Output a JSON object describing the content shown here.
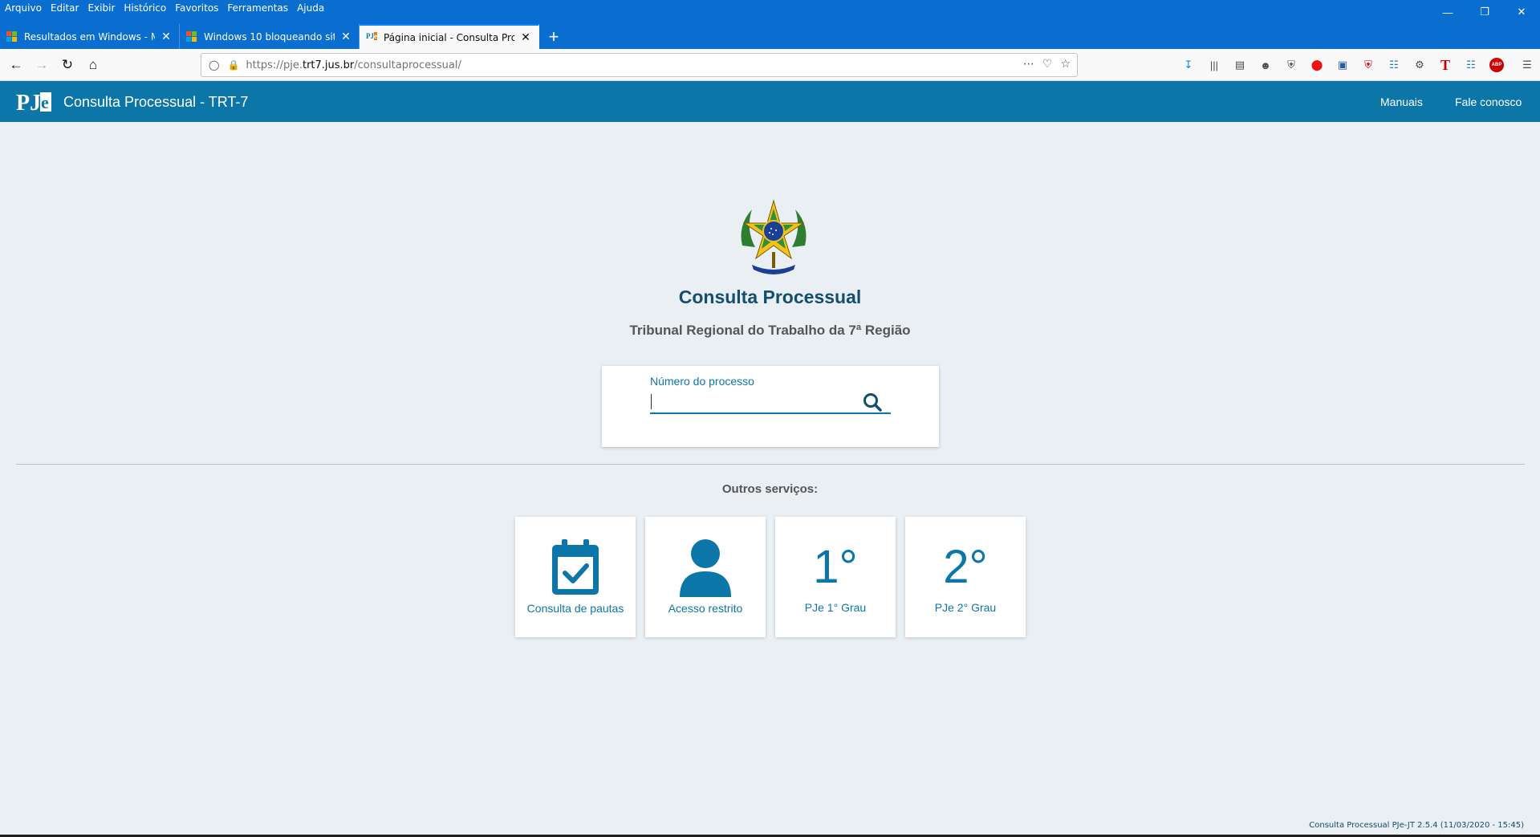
{
  "browser": {
    "menu": [
      "Arquivo",
      "Editar",
      "Exibir",
      "Histórico",
      "Favoritos",
      "Ferramentas",
      "Ajuda"
    ],
    "tabs": [
      {
        "title": "Resultados em Windows - Mic"
      },
      {
        "title": "Windows 10 bloqueando sites"
      },
      {
        "title": "Página inicial - Consulta Proce"
      }
    ],
    "new_tab": "+",
    "url_prefix": "https://pje.",
    "url_host": "trt7.jus.br",
    "url_path": "/consultaprocessual/"
  },
  "header": {
    "logo": "PJe",
    "title": "Consulta Processual - TRT-7",
    "links": {
      "manuals": "Manuais",
      "contact": "Fale conosco"
    },
    "bg_color": "#0d76a8"
  },
  "main": {
    "title": "Consulta Processual",
    "subtitle": "Tribunal Regional do Trabalho da 7ª Região",
    "search": {
      "label": "Número do processo",
      "value": ""
    },
    "others_label": "Outros serviços:",
    "services": [
      {
        "label": "Consulta de pautas",
        "icon": "calendar-check-icon"
      },
      {
        "label": "Acesso restrito",
        "icon": "user-icon"
      },
      {
        "big": "1°",
        "label": "PJe 1° Grau"
      },
      {
        "big": "2°",
        "label": "PJe 2° Grau"
      }
    ]
  },
  "footer": {
    "version": "Consulta Processual PJe-JT 2.5.4 (11/03/2020 - 15:45)"
  }
}
